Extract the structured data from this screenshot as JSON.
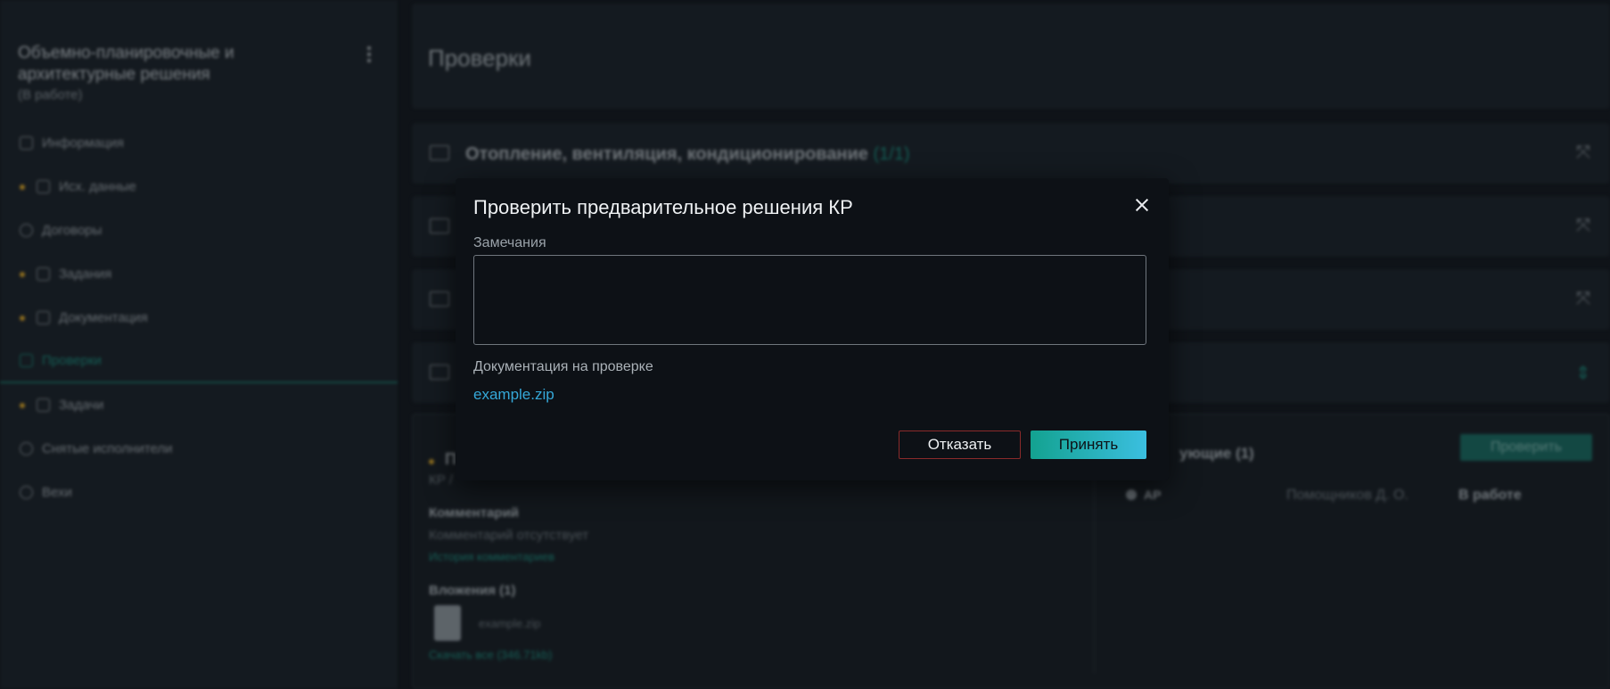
{
  "sidebar": {
    "title": "Объемно-планировочные и архитектурные решения",
    "status": "(В работе)",
    "items": [
      {
        "label": "Информация",
        "dot": false
      },
      {
        "label": "Исх. данные",
        "dot": true
      },
      {
        "label": "Договоры",
        "dot": false
      },
      {
        "label": "Задания",
        "dot": true
      },
      {
        "label": "Документация",
        "dot": true
      },
      {
        "label": "Проверки",
        "dot": false,
        "active": true
      },
      {
        "label": "Задачи",
        "dot": true
      },
      {
        "label": "Снятые исполнители",
        "dot": false
      },
      {
        "label": "Вехи",
        "dot": false
      }
    ]
  },
  "main": {
    "title": "Проверки",
    "sections": [
      {
        "title": "Отопление, вентиляция, кондиционирование",
        "count": "(1/1)"
      }
    ],
    "detail": {
      "prefix": "П",
      "sub": "КР /",
      "comment_label": "Комментарий",
      "comment_text": "Комментарий отсутствует",
      "comment_history": "История комментариев",
      "attachments_label": "Вложения (1)",
      "attachment_name": "example.zip",
      "download_all": "Скачать все (346.71kb)",
      "checkers_label": "ующие (1)",
      "check_button": "Проверить",
      "row_code": "АР",
      "row_person": "Помощников Д. О.",
      "row_status": "В работе"
    }
  },
  "modal": {
    "title": "Проверить предварительное решения КР",
    "remarks_label": "Замечания",
    "remarks_value": "",
    "docs_label": "Документация на проверке",
    "doc_file": "example.zip",
    "reject_label": "Отказать",
    "accept_label": "Принять"
  },
  "colors": {
    "accent": "#1e8a7c",
    "link": "#35a8d8",
    "warning_dot": "#d2a12a",
    "reject_border": "#8a2a2a"
  }
}
